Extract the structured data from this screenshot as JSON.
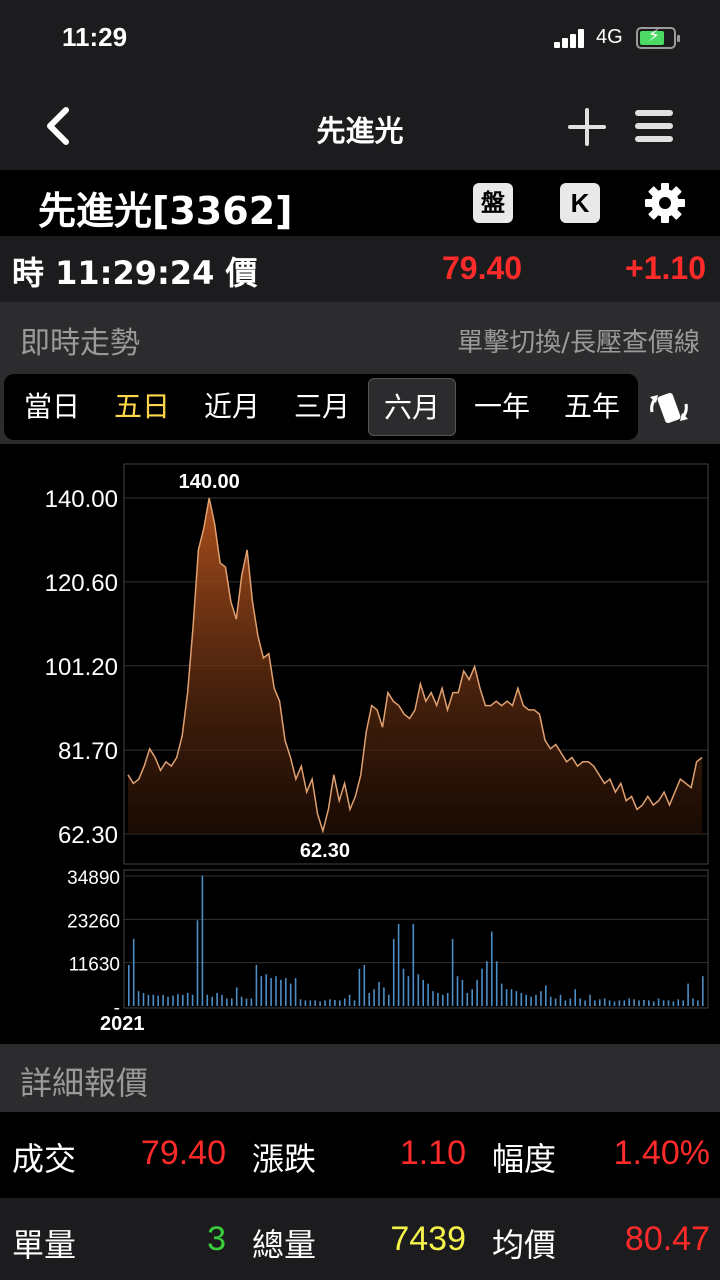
{
  "status": {
    "time": "11:29",
    "network": "4G"
  },
  "nav": {
    "title": "先進光"
  },
  "stock": {
    "name": "先進光[3362]",
    "pan_label": "盤",
    "k_label": "K"
  },
  "quote": {
    "time_label": "時 11:29:24 價",
    "price": "79.40",
    "change": "+1.10",
    "color": "#ff2a2a"
  },
  "section": {
    "title": "即時走勢",
    "hint": "單擊切換/長壓查價線"
  },
  "ranges": [
    {
      "label": "當日"
    },
    {
      "label": "五日",
      "highlighted": true
    },
    {
      "label": "近月"
    },
    {
      "label": "三月"
    },
    {
      "label": "六月",
      "active": true
    },
    {
      "label": "一年"
    },
    {
      "label": "五年"
    }
  ],
  "chart_data": {
    "type": "area",
    "y_ticks": [
      "140.00",
      "120.60",
      "101.20",
      "81.70",
      "62.30"
    ],
    "ylim": [
      62.3,
      140.0
    ],
    "max_label": "140.00",
    "min_label": "62.30",
    "year_label": "2021",
    "prices": [
      76,
      74,
      75,
      78,
      82,
      80,
      77,
      79,
      78,
      80,
      85,
      95,
      110,
      128,
      133,
      140,
      134,
      125,
      124,
      116,
      112,
      122,
      128,
      116,
      108,
      103,
      104,
      96,
      93,
      84,
      80,
      75,
      78,
      72,
      75,
      67,
      63,
      68,
      76,
      70,
      74,
      68,
      71,
      76,
      86,
      92,
      91,
      87,
      95,
      93,
      92,
      90,
      89,
      91,
      97,
      93,
      95,
      92,
      96,
      91,
      95,
      95,
      100,
      98,
      101,
      96,
      92,
      92,
      93,
      92,
      93,
      92,
      96,
      92,
      91,
      91,
      90,
      84,
      82,
      83,
      81,
      79,
      80,
      78,
      79,
      79,
      78,
      76,
      74,
      75,
      72,
      74,
      70,
      71,
      68,
      69,
      71,
      69,
      70,
      72,
      69,
      72,
      75,
      74,
      73,
      79,
      80
    ],
    "volume_ticks": [
      "34890",
      "23260",
      "11630",
      "-"
    ],
    "volume_max": 34890,
    "volumes": [
      11000,
      18000,
      4000,
      3500,
      3000,
      3000,
      2800,
      3000,
      2500,
      2800,
      3200,
      3000,
      3500,
      3000,
      23000,
      35000,
      3000,
      2500,
      3500,
      3000,
      2000,
      2000,
      5000,
      2500,
      2000,
      2000,
      11000,
      8000,
      8500,
      7500,
      8000,
      7000,
      7500,
      6000,
      7500,
      1800,
      1500,
      1500,
      1500,
      1200,
      1500,
      1800,
      1600,
      1500,
      2000,
      3000,
      1500,
      10000,
      11000,
      3500,
      4500,
      6500,
      5000,
      3000,
      18000,
      22000,
      10000,
      8000,
      22000,
      8500,
      7000,
      6000,
      4000,
      3500,
      3000,
      3500,
      18000,
      8000,
      7000,
      3500,
      4500,
      7000,
      10000,
      12000,
      20000,
      12000,
      6000,
      4500,
      4500,
      4000,
      3500,
      3000,
      2500,
      3000,
      4000,
      5500,
      2500,
      2000,
      3000,
      1500,
      2000,
      4500,
      2000,
      1500,
      3000,
      1500,
      1800,
      2000,
      1500,
      1200,
      1500,
      1500,
      2000,
      1800,
      1500,
      1600,
      1500,
      1200,
      2000,
      1500,
      1500,
      1200,
      1800,
      1500,
      6000,
      2000,
      1500,
      8000
    ]
  },
  "detail": {
    "title": "詳細報價",
    "rows": [
      [
        {
          "label": "成交",
          "value": "79.40",
          "color": "#ff2a2a"
        },
        {
          "label": "漲跌",
          "value": "1.10",
          "color": "#ff2a2a"
        },
        {
          "label": "幅度",
          "value": "1.40%",
          "color": "#ff2a2a"
        }
      ],
      [
        {
          "label": "單量",
          "value": "3",
          "color": "#3ccf3c"
        },
        {
          "label": "總量",
          "value": "7439",
          "color": "#f5f24a"
        },
        {
          "label": "均價",
          "value": "80.47",
          "color": "#ff2a2a"
        }
      ]
    ]
  }
}
